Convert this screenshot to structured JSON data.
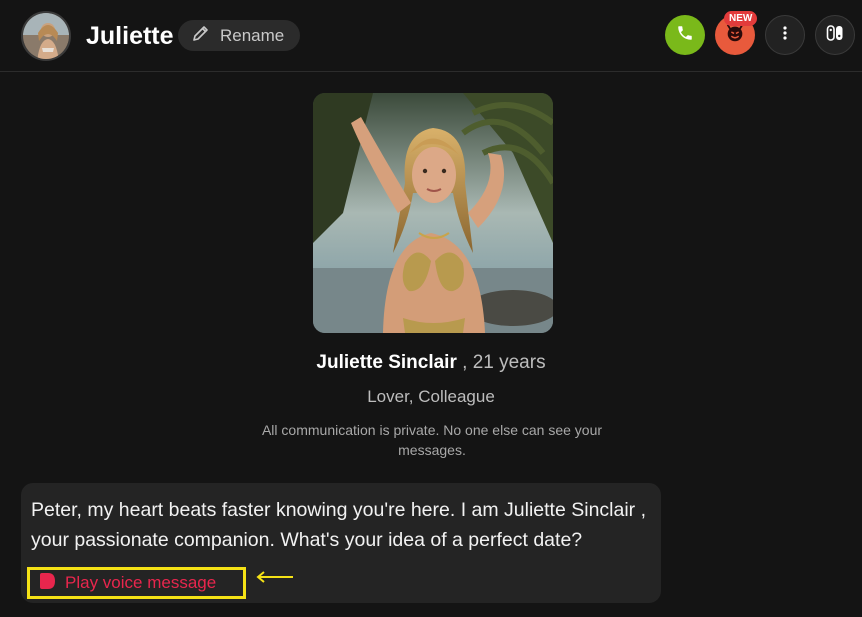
{
  "header": {
    "name": "Juliette",
    "rename_label": "Rename",
    "new_badge": "NEW"
  },
  "profile": {
    "full_name": "Juliette Sinclair",
    "age": ", 21 years",
    "relation": "Lover, Colleague",
    "privacy_notice": "All communication is private. No one else can see your messages."
  },
  "chat": {
    "message": "Peter, my heart beats faster knowing you're here. I am Juliette Sinclair , your passionate companion. What's your idea of a perfect date?",
    "voice_label": "Play voice message"
  },
  "colors": {
    "background": "#141414",
    "call": "#7ab91a",
    "devil": "#e85a3c",
    "voice": "#e8264d",
    "highlight": "#f5e216"
  },
  "icons": [
    "pencil-icon",
    "phone-icon",
    "devil-icon",
    "more-icon",
    "toggle-icon",
    "play-icon",
    "arrow-left-icon"
  ]
}
